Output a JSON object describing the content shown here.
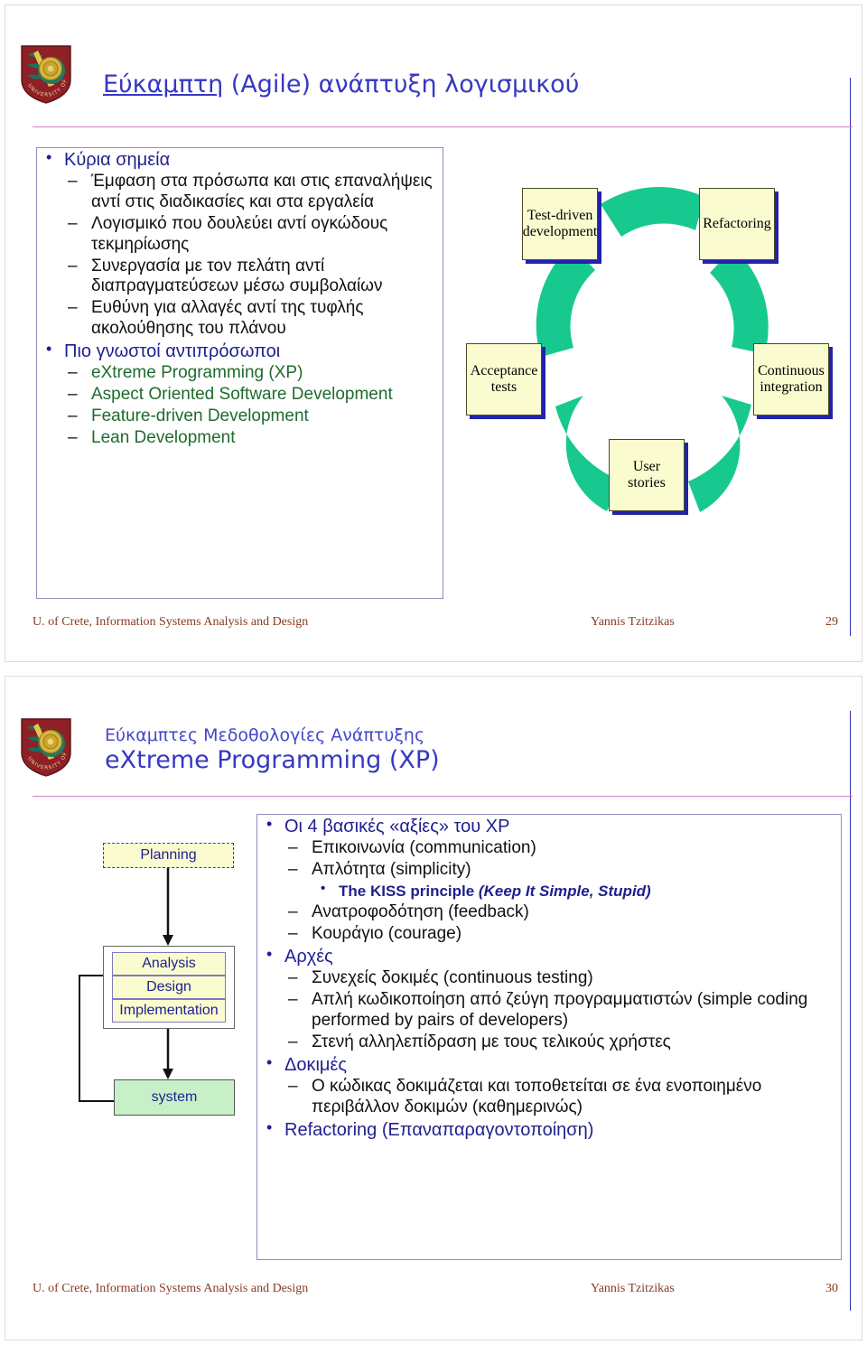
{
  "slide1": {
    "title": {
      "underlined": "Εύκαμπτη",
      "rest": " (Agile) ανάπτυξη λογισμικού"
    },
    "bullets": [
      {
        "level": 1,
        "text": "Κύρια σημεία",
        "style": "navy"
      },
      {
        "level": 2,
        "text": "Έμφαση στα πρόσωπα και στις επαναλήψεις αντί στις διαδικασίες και στα εργαλεία",
        "style": "black"
      },
      {
        "level": 2,
        "text": "Λογισμικό που δουλεύει αντί ογκώδους τεκμηρίωσης",
        "style": "black"
      },
      {
        "level": 2,
        "text": "Συνεργασία με τον πελάτη αντί διαπραγματεύσεων μέσω συμβολαίων",
        "style": "black"
      },
      {
        "level": 2,
        "text": "Ευθύνη για αλλαγές αντί της τυφλής ακολούθησης του πλάνου",
        "style": "black"
      },
      {
        "level": 1,
        "text": "Πιο γνωστοί αντιπρόσωποι",
        "style": "navy"
      },
      {
        "level": 2,
        "text": "eXtreme Programming (XP)",
        "style": "green"
      },
      {
        "level": 2,
        "text": "Aspect Oriented Software Development",
        "style": "green"
      },
      {
        "level": 2,
        "text": "Feature-driven Development",
        "style": "green"
      },
      {
        "level": 2,
        "text": "Lean Development",
        "style": "green"
      }
    ],
    "cycle": {
      "nodes": [
        {
          "id": "test-driven-development",
          "lines": [
            "Test-driven",
            "development"
          ]
        },
        {
          "id": "refactoring",
          "lines": [
            "Refactoring"
          ]
        },
        {
          "id": "continuous-integration",
          "lines": [
            "Continuous",
            "integration"
          ]
        },
        {
          "id": "user-stories",
          "lines": [
            "User",
            "stories"
          ]
        },
        {
          "id": "acceptance-tests",
          "lines": [
            "Acceptance",
            "tests"
          ]
        }
      ],
      "arc_color": "#17c98e",
      "node_fill": "#fbfbd0",
      "node_shadow": "#2222aa"
    },
    "footer": {
      "left": "U. of Crete, Information Systems Analysis and Design",
      "center": "Yannis Tzitzikas",
      "page": "29"
    }
  },
  "slide2": {
    "title": {
      "sup": "Εύκαμπτες Μεδοθολογίες Ανάπτυξης",
      "main": "eXtreme Programming (XP)"
    },
    "flow": {
      "planning": "Planning",
      "analysis": "Analysis",
      "design": "Design",
      "implementation": "Implementation",
      "system": "system"
    },
    "bullets": [
      {
        "level": 1,
        "text": "Οι 4 βασικές «αξίες» του XP",
        "style": "navy"
      },
      {
        "level": 2,
        "text": "Επικοινωνία (communication)",
        "style": "black"
      },
      {
        "level": 2,
        "text": "Απλότητα (simplicity)",
        "style": "black"
      },
      {
        "level": 3,
        "text": "The KISS principle ",
        "italic": "(Keep It Simple, Stupid)",
        "style": "navy"
      },
      {
        "level": 2,
        "text": "Ανατροφοδότηση (feedback)",
        "style": "black"
      },
      {
        "level": 2,
        "text": "Κουράγιο (courage)",
        "style": "black"
      },
      {
        "level": 1,
        "text": "Αρχές",
        "style": "navy"
      },
      {
        "level": 2,
        "text": "Συνεχείς δοκιμές (continuous testing)",
        "style": "black"
      },
      {
        "level": 2,
        "text": "Απλή κωδικοποίηση από ζεύγη προγραμματιστών (simple coding performed by pairs of developers)",
        "style": "black"
      },
      {
        "level": 2,
        "text": "Στενή αλληλεπίδραση με τους τελικούς χρήστες",
        "style": "black"
      },
      {
        "level": 1,
        "text": "Δοκιμές",
        "style": "navy"
      },
      {
        "level": 2,
        "text": "Ο κώδικας δοκιμάζεται και τοποθετείται σε ένα ενοποιημένο  περιβάλλον δοκιμών (καθημερινώς)",
        "style": "black"
      },
      {
        "level": 1,
        "text": "Refactoring (Επαναπαραγοντοποίηση)",
        "style": "navy"
      }
    ],
    "footer": {
      "left": "U. of Crete, Information Systems Analysis and Design",
      "center": "Yannis Tzitzikas",
      "page": "30"
    }
  },
  "logo": {
    "name": "university-of-crete-seal",
    "ring_text": "UNIVERSITY OF CRETE"
  }
}
